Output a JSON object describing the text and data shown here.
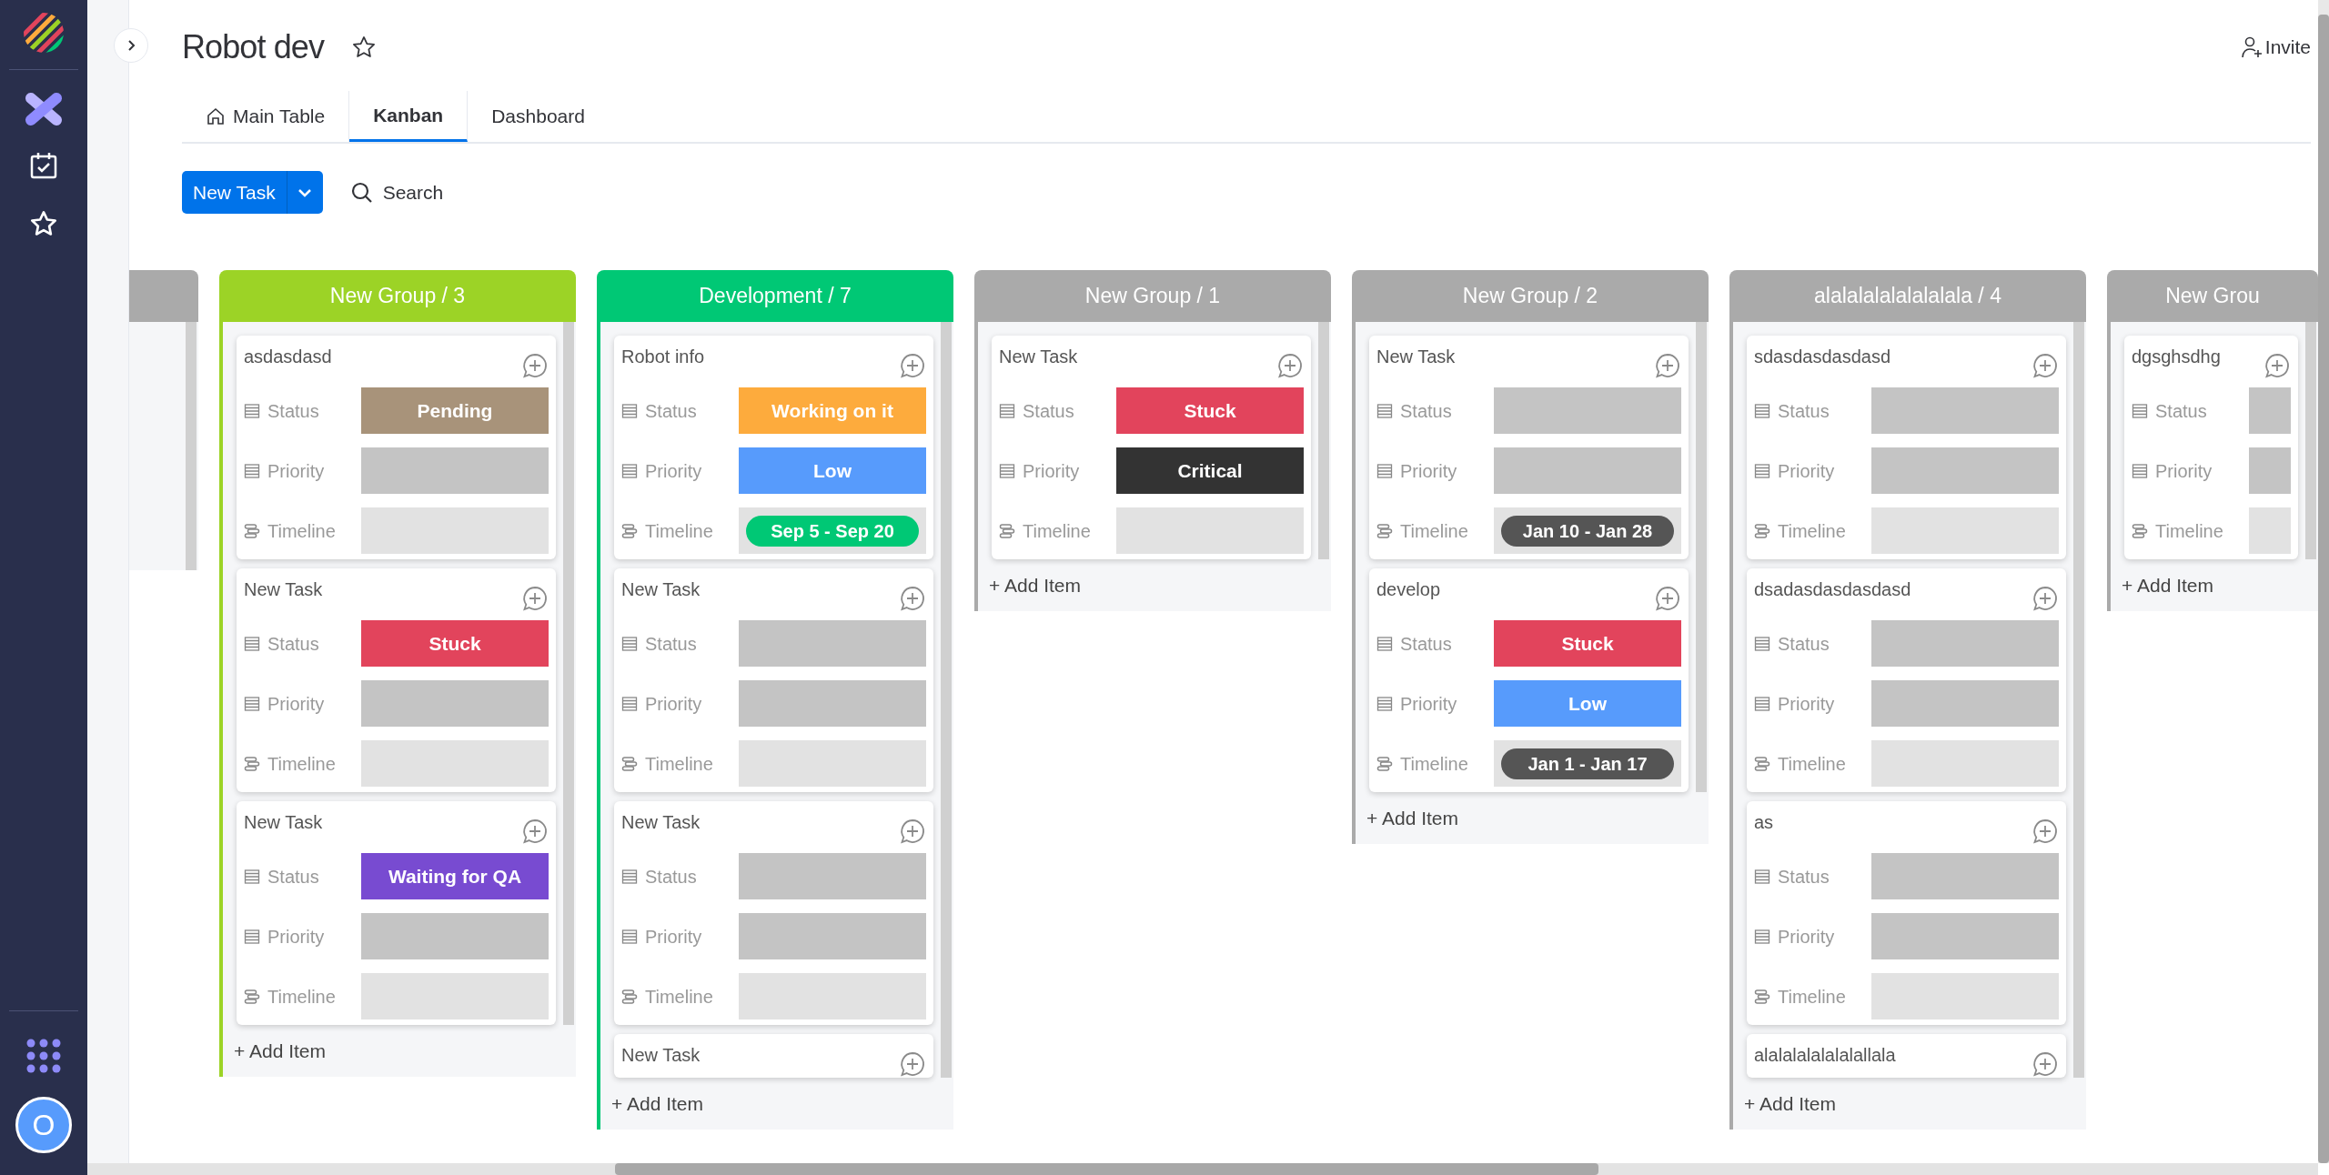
{
  "sidebar": {
    "avatar": "O"
  },
  "header": {
    "title": "Robot dev",
    "invite": "Invite"
  },
  "tabs": [
    {
      "label": "Main Table",
      "selected": false
    },
    {
      "label": "Kanban",
      "selected": true
    },
    {
      "label": "Dashboard",
      "selected": false
    }
  ],
  "toolbar": {
    "new_button": "New Task",
    "search": "Search"
  },
  "columns": [
    {
      "color": "#aaaaaa"
    },
    {
      "title": "New Group / 3",
      "color": "#9cd326",
      "add_item": "+ Add Item",
      "cards": [
        {
          "title": "asdasdasd",
          "fields": [
            {
              "kind": "status",
              "label": "Status",
              "value": "Pending",
              "color": "#a8937a"
            },
            {
              "kind": "priority",
              "label": "Priority"
            },
            {
              "kind": "timeline",
              "label": "Timeline"
            }
          ]
        },
        {
          "title": "New Task",
          "fields": [
            {
              "kind": "status",
              "label": "Status",
              "value": "Stuck",
              "color": "#e2445c"
            },
            {
              "kind": "priority",
              "label": "Priority"
            },
            {
              "kind": "timeline",
              "label": "Timeline"
            }
          ]
        },
        {
          "title": "New Task",
          "fields": [
            {
              "kind": "status",
              "label": "Status",
              "value": "Waiting for QA",
              "color": "#784bd1"
            },
            {
              "kind": "priority",
              "label": "Priority"
            },
            {
              "kind": "timeline",
              "label": "Timeline"
            }
          ]
        }
      ]
    },
    {
      "title": "Development / 7",
      "color": "#00c875",
      "add_item": "+ Add Item",
      "cards": [
        {
          "title": "Robot info",
          "fields": [
            {
              "kind": "status",
              "label": "Status",
              "value": "Working on it",
              "color": "#fdab3d"
            },
            {
              "kind": "priority",
              "label": "Priority",
              "value": "Low",
              "color": "#579bfc"
            },
            {
              "kind": "timeline",
              "label": "Timeline",
              "value": "Sep 5 - Sep 20",
              "color": "#00c875"
            }
          ]
        },
        {
          "title": "New Task",
          "fields": [
            {
              "kind": "status",
              "label": "Status"
            },
            {
              "kind": "priority",
              "label": "Priority"
            },
            {
              "kind": "timeline",
              "label": "Timeline"
            }
          ]
        },
        {
          "title": "New Task",
          "fields": [
            {
              "kind": "status",
              "label": "Status"
            },
            {
              "kind": "priority",
              "label": "Priority"
            },
            {
              "kind": "timeline",
              "label": "Timeline"
            }
          ]
        },
        {
          "title": "New Task"
        }
      ]
    },
    {
      "title": "New Group / 1",
      "color": "#aaaaaa",
      "add_item": "+ Add Item",
      "cards": [
        {
          "title": "New Task",
          "fields": [
            {
              "kind": "status",
              "label": "Status",
              "value": "Stuck",
              "color": "#e2445c"
            },
            {
              "kind": "priority",
              "label": "Priority",
              "value": "Critical",
              "color": "#333333"
            },
            {
              "kind": "timeline",
              "label": "Timeline"
            }
          ]
        }
      ]
    },
    {
      "title": "New Group / 2",
      "color": "#aaaaaa",
      "add_item": "+ Add Item",
      "cards": [
        {
          "title": "New Task",
          "fields": [
            {
              "kind": "status",
              "label": "Status"
            },
            {
              "kind": "priority",
              "label": "Priority"
            },
            {
              "kind": "timeline",
              "label": "Timeline",
              "value": "Jan 10 - Jan 28",
              "color": "#555555"
            }
          ]
        },
        {
          "title": "develop",
          "fields": [
            {
              "kind": "status",
              "label": "Status",
              "value": "Stuck",
              "color": "#e2445c"
            },
            {
              "kind": "priority",
              "label": "Priority",
              "value": "Low",
              "color": "#579bfc"
            },
            {
              "kind": "timeline",
              "label": "Timeline",
              "value": "Jan 1 - Jan 17",
              "color": "#555555"
            }
          ]
        }
      ]
    },
    {
      "title": "alalalalalalalalala / 4",
      "color": "#aaaaaa",
      "add_item": "+ Add Item",
      "cards": [
        {
          "title": "sdasdasdasdasd",
          "fields": [
            {
              "kind": "status",
              "label": "Status"
            },
            {
              "kind": "priority",
              "label": "Priority"
            },
            {
              "kind": "timeline",
              "label": "Timeline"
            }
          ]
        },
        {
          "title": "dsadasdasdasdasd",
          "fields": [
            {
              "kind": "status",
              "label": "Status"
            },
            {
              "kind": "priority",
              "label": "Priority"
            },
            {
              "kind": "timeline",
              "label": "Timeline"
            }
          ]
        },
        {
          "title": "as",
          "fields": [
            {
              "kind": "status",
              "label": "Status"
            },
            {
              "kind": "priority",
              "label": "Priority"
            },
            {
              "kind": "timeline",
              "label": "Timeline"
            }
          ]
        },
        {
          "title": "alalalalalalalallala"
        }
      ]
    },
    {
      "title": "New Grou",
      "color": "#aaaaaa",
      "add_item": "+ Add Item",
      "cards": [
        {
          "title": "dgsghsdhg",
          "fields": [
            {
              "kind": "status",
              "label": "Status"
            },
            {
              "kind": "priority",
              "label": "Priority"
            },
            {
              "kind": "timeline",
              "label": "Timeline"
            }
          ]
        }
      ]
    }
  ]
}
